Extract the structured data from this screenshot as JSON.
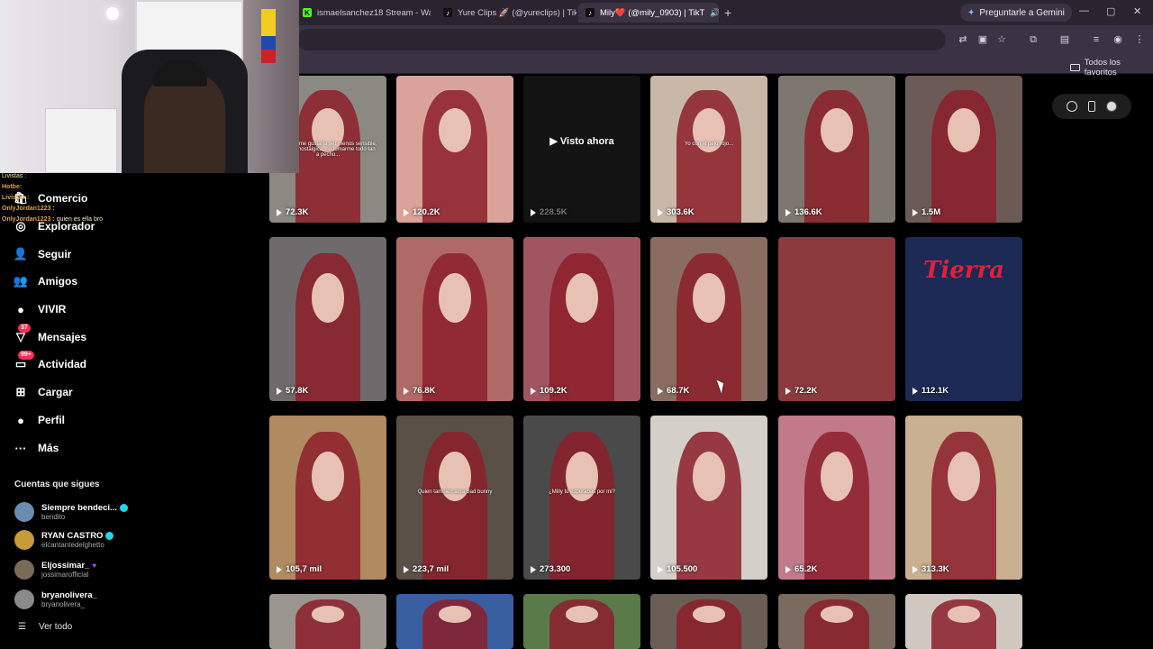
{
  "browser": {
    "tabs": [
      {
        "title": "ismaelsanchez18 Stream - Wat",
        "icon_color": "#53fc18",
        "icon_text": "K",
        "active": false
      },
      {
        "title": "Yure Clips 🚀 (@yureclips) | Tik",
        "icon_color": "#111111",
        "icon_text": "♪",
        "active": false
      },
      {
        "title": "Mily❤️ (@mily_0903) | TikT",
        "icon_color": "#111111",
        "icon_text": "♪",
        "active": true
      }
    ],
    "new_tab": "+",
    "gemini_label": "Preguntarle a Gemini",
    "bookmarks_label": "Todos los favoritos",
    "window_controls": [
      "—",
      "▢",
      "✕"
    ]
  },
  "chat": [
    {
      "user": "",
      "text": "",
      "dim": true
    },
    {
      "user": "",
      "text": "",
      "dim": true
    },
    {
      "user": "",
      "text": "Livistas :",
      "dim": false
    },
    {
      "user": "Hotbe:",
      "text": "",
      "dim": false
    },
    {
      "user": "Livistas :",
      "text": "",
      "dim": false
    },
    {
      "user": "OnlyJordan1223 :",
      "text": "",
      "dim": false
    },
    {
      "user": "OnlyJordan1223 :",
      "text": "quien es ella bro",
      "dim": false
    }
  ],
  "sidebar": {
    "items": [
      {
        "label": "Comercio",
        "icon": "shop-icon",
        "glyph": "🛍",
        "badge": ""
      },
      {
        "label": "Explorador",
        "icon": "compass-icon",
        "glyph": "◎",
        "badge": ""
      },
      {
        "label": "Seguir",
        "icon": "following-icon",
        "glyph": "👤",
        "badge": ""
      },
      {
        "label": "Amigos",
        "icon": "friends-icon",
        "glyph": "👥",
        "badge": ""
      },
      {
        "label": "VIVIR",
        "icon": "live-icon",
        "glyph": "●",
        "badge": ""
      },
      {
        "label": "Mensajes",
        "icon": "messages-icon",
        "glyph": "▽",
        "badge": "37"
      },
      {
        "label": "Actividad",
        "icon": "activity-icon",
        "glyph": "▭",
        "badge": "99+"
      },
      {
        "label": "Cargar",
        "icon": "upload-icon",
        "glyph": "⊞",
        "badge": ""
      },
      {
        "label": "Perfil",
        "icon": "profile-icon",
        "glyph": "●",
        "badge": ""
      },
      {
        "label": "Más",
        "icon": "more-icon",
        "glyph": "···",
        "badge": ""
      }
    ],
    "following_title": "Cuentas que sigues",
    "following": [
      {
        "name": "Siempre bendeci...",
        "handle": "bendito",
        "verified": true,
        "heart": false,
        "avatar_color": "#6a8caf"
      },
      {
        "name": "RYAN CASTRO",
        "handle": "elcantantedelghetto",
        "verified": true,
        "heart": false,
        "avatar_color": "#c79a3a"
      },
      {
        "name": "Eljossimar_",
        "handle": "jossimarofficial",
        "verified": false,
        "heart": true,
        "avatar_color": "#7a6a5a"
      },
      {
        "name": "bryanolivera_",
        "handle": "bryanolivera_",
        "verified": false,
        "heart": false,
        "avatar_color": "#8a8a8a"
      }
    ],
    "see_all": "Ver todo"
  },
  "videos": [
    {
      "views": "72.3K",
      "caption": "a veces me gustaría ser menos sensible, menos nostálgica, no tomarme todo tan a pecho...",
      "bg": "#8a8a82",
      "hair": true,
      "watched": false
    },
    {
      "views": "120.2K",
      "caption": "",
      "bg": "#d9a39a",
      "hair": true,
      "watched": false
    },
    {
      "views": "228.5K",
      "caption": "",
      "bg": "#2a2a2e",
      "hair": false,
      "watched": true,
      "watched_label": "Visto ahora"
    },
    {
      "views": "303.6K",
      "caption": "Yo con el pelo rojo...",
      "bg": "#c9b8a7",
      "hair": true,
      "watched": false
    },
    {
      "views": "136.6K",
      "caption": "",
      "bg": "#7d776f",
      "hair": true,
      "watched": false
    },
    {
      "views": "1.5M",
      "caption": "",
      "bg": "#6b5a56",
      "hair": true,
      "watched": false
    },
    {
      "views": "57.8K",
      "caption": "",
      "bg": "#6f6a6c",
      "hair": true,
      "watched": false
    },
    {
      "views": "76.8K",
      "caption": "",
      "bg": "#b06a66",
      "hair": true,
      "watched": false
    },
    {
      "views": "109.2K",
      "caption": "",
      "bg": "#a05560",
      "hair": true,
      "watched": false
    },
    {
      "views": "68.7K",
      "caption": "",
      "bg": "#8a6c60",
      "hair": true,
      "watched": false
    },
    {
      "views": "72.2K",
      "caption": "",
      "bg": "#8c3a3e",
      "hair": false,
      "watched": false
    },
    {
      "views": "112.1K",
      "caption": "",
      "bg": "#1c2a55",
      "hair": false,
      "watched": false,
      "title_text": "Tierra"
    },
    {
      "views": "105,7 mil",
      "caption": "",
      "bg": "#b08a60",
      "hair": true,
      "watched": false
    },
    {
      "views": "223,7 mil",
      "caption": "Quien también ama Bad bunny",
      "bg": "#5a5048",
      "hair": true,
      "watched": false
    },
    {
      "views": "273.300",
      "caption": "¿Milly tú esperabas por mi?",
      "bg": "#4a4a4a",
      "hair": true,
      "watched": false
    },
    {
      "views": "105.500",
      "caption": "",
      "bg": "#d4cfc8",
      "hair": true,
      "watched": false
    },
    {
      "views": "65.2K",
      "caption": "",
      "bg": "#c07a8a",
      "hair": true,
      "watched": false
    },
    {
      "views": "313.3K",
      "caption": "",
      "bg": "#c8b090",
      "hair": true,
      "watched": false
    },
    {
      "views": "",
      "caption": "",
      "bg": "#9a958e",
      "hair": true,
      "watched": false
    },
    {
      "views": "",
      "caption": "",
      "bg": "#3a5fa0",
      "hair": true,
      "watched": false
    },
    {
      "views": "",
      "caption": "",
      "bg": "#5a7a4a",
      "hair": true,
      "watched": false
    },
    {
      "views": "",
      "caption": "",
      "bg": "#6a5e56",
      "hair": true,
      "watched": false
    },
    {
      "views": "",
      "caption": "",
      "bg": "#7a6a60",
      "hair": true,
      "watched": false
    },
    {
      "views": "",
      "caption": "",
      "bg": "#d0c8c0",
      "hair": true,
      "watched": false
    }
  ]
}
